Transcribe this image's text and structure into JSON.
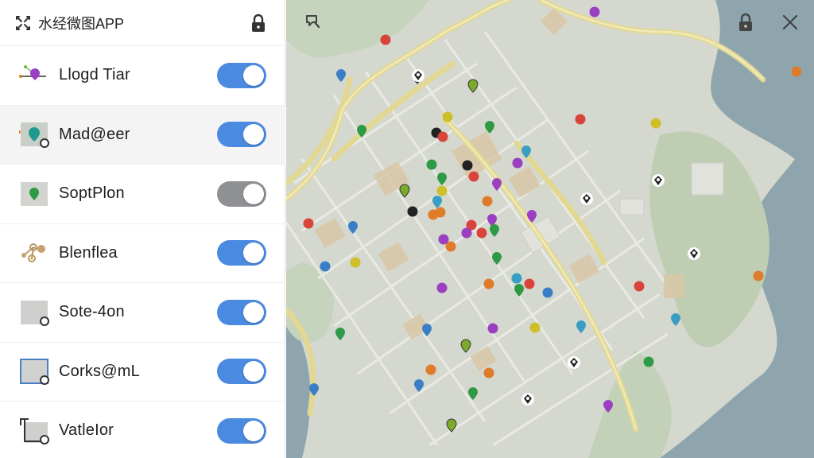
{
  "app": {
    "title": "水经微图APP"
  },
  "sidebar": {
    "layers": [
      {
        "label": "Llogd Tiar",
        "enabled": true,
        "icon": "purple-pin-route-icon"
      },
      {
        "label": "Mad@eer",
        "enabled": true,
        "icon": "teal-pin-map-icon"
      },
      {
        "label": "SoptPlon",
        "enabled": false,
        "icon": "green-pin-icon"
      },
      {
        "label": "Blenflea",
        "enabled": true,
        "icon": "node-cluster-icon"
      },
      {
        "label": "Sote-4on",
        "enabled": true,
        "icon": "gray-square-icon"
      },
      {
        "label": "Corks@mL",
        "enabled": true,
        "icon": "blue-square-icon"
      },
      {
        "label": "VatleIor",
        "enabled": true,
        "icon": "crop-frame-icon"
      }
    ]
  },
  "colors": {
    "toggle_on": "#4a8ae0",
    "toggle_off": "#8e9093",
    "water": "#8ea4ae",
    "park": "#bccdb0",
    "road_major": "#e3d796"
  }
}
